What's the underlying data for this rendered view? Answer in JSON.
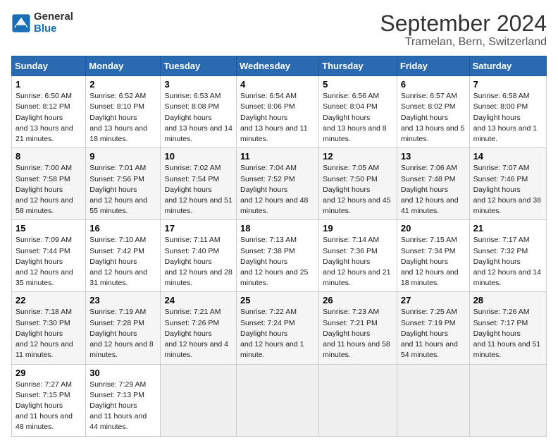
{
  "logo": {
    "text_general": "General",
    "text_blue": "Blue"
  },
  "title": "September 2024",
  "subtitle": "Tramelan, Bern, Switzerland",
  "days_of_week": [
    "Sunday",
    "Monday",
    "Tuesday",
    "Wednesday",
    "Thursday",
    "Friday",
    "Saturday"
  ],
  "weeks": [
    [
      {
        "day": "1",
        "sunrise": "6:50 AM",
        "sunset": "8:12 PM",
        "daylight": "13 hours and 21 minutes."
      },
      {
        "day": "2",
        "sunrise": "6:52 AM",
        "sunset": "8:10 PM",
        "daylight": "13 hours and 18 minutes."
      },
      {
        "day": "3",
        "sunrise": "6:53 AM",
        "sunset": "8:08 PM",
        "daylight": "13 hours and 14 minutes."
      },
      {
        "day": "4",
        "sunrise": "6:54 AM",
        "sunset": "8:06 PM",
        "daylight": "13 hours and 11 minutes."
      },
      {
        "day": "5",
        "sunrise": "6:56 AM",
        "sunset": "8:04 PM",
        "daylight": "13 hours and 8 minutes."
      },
      {
        "day": "6",
        "sunrise": "6:57 AM",
        "sunset": "8:02 PM",
        "daylight": "13 hours and 5 minutes."
      },
      {
        "day": "7",
        "sunrise": "6:58 AM",
        "sunset": "8:00 PM",
        "daylight": "13 hours and 1 minute."
      }
    ],
    [
      {
        "day": "8",
        "sunrise": "7:00 AM",
        "sunset": "7:58 PM",
        "daylight": "12 hours and 58 minutes."
      },
      {
        "day": "9",
        "sunrise": "7:01 AM",
        "sunset": "7:56 PM",
        "daylight": "12 hours and 55 minutes."
      },
      {
        "day": "10",
        "sunrise": "7:02 AM",
        "sunset": "7:54 PM",
        "daylight": "12 hours and 51 minutes."
      },
      {
        "day": "11",
        "sunrise": "7:04 AM",
        "sunset": "7:52 PM",
        "daylight": "12 hours and 48 minutes."
      },
      {
        "day": "12",
        "sunrise": "7:05 AM",
        "sunset": "7:50 PM",
        "daylight": "12 hours and 45 minutes."
      },
      {
        "day": "13",
        "sunrise": "7:06 AM",
        "sunset": "7:48 PM",
        "daylight": "12 hours and 41 minutes."
      },
      {
        "day": "14",
        "sunrise": "7:07 AM",
        "sunset": "7:46 PM",
        "daylight": "12 hours and 38 minutes."
      }
    ],
    [
      {
        "day": "15",
        "sunrise": "7:09 AM",
        "sunset": "7:44 PM",
        "daylight": "12 hours and 35 minutes."
      },
      {
        "day": "16",
        "sunrise": "7:10 AM",
        "sunset": "7:42 PM",
        "daylight": "12 hours and 31 minutes."
      },
      {
        "day": "17",
        "sunrise": "7:11 AM",
        "sunset": "7:40 PM",
        "daylight": "12 hours and 28 minutes."
      },
      {
        "day": "18",
        "sunrise": "7:13 AM",
        "sunset": "7:38 PM",
        "daylight": "12 hours and 25 minutes."
      },
      {
        "day": "19",
        "sunrise": "7:14 AM",
        "sunset": "7:36 PM",
        "daylight": "12 hours and 21 minutes."
      },
      {
        "day": "20",
        "sunrise": "7:15 AM",
        "sunset": "7:34 PM",
        "daylight": "12 hours and 18 minutes."
      },
      {
        "day": "21",
        "sunrise": "7:17 AM",
        "sunset": "7:32 PM",
        "daylight": "12 hours and 14 minutes."
      }
    ],
    [
      {
        "day": "22",
        "sunrise": "7:18 AM",
        "sunset": "7:30 PM",
        "daylight": "12 hours and 11 minutes."
      },
      {
        "day": "23",
        "sunrise": "7:19 AM",
        "sunset": "7:28 PM",
        "daylight": "12 hours and 8 minutes."
      },
      {
        "day": "24",
        "sunrise": "7:21 AM",
        "sunset": "7:26 PM",
        "daylight": "12 hours and 4 minutes."
      },
      {
        "day": "25",
        "sunrise": "7:22 AM",
        "sunset": "7:24 PM",
        "daylight": "12 hours and 1 minute."
      },
      {
        "day": "26",
        "sunrise": "7:23 AM",
        "sunset": "7:21 PM",
        "daylight": "11 hours and 58 minutes."
      },
      {
        "day": "27",
        "sunrise": "7:25 AM",
        "sunset": "7:19 PM",
        "daylight": "11 hours and 54 minutes."
      },
      {
        "day": "28",
        "sunrise": "7:26 AM",
        "sunset": "7:17 PM",
        "daylight": "11 hours and 51 minutes."
      }
    ],
    [
      {
        "day": "29",
        "sunrise": "7:27 AM",
        "sunset": "7:15 PM",
        "daylight": "11 hours and 48 minutes."
      },
      {
        "day": "30",
        "sunrise": "7:29 AM",
        "sunset": "7:13 PM",
        "daylight": "11 hours and 44 minutes."
      },
      null,
      null,
      null,
      null,
      null
    ]
  ]
}
